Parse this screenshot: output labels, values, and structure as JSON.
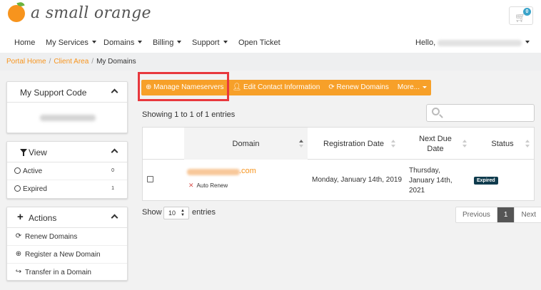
{
  "brand": {
    "logo_text": "a small orange",
    "orange_color": "#f7941d",
    "leaf_color": "#6cb33f"
  },
  "cart": {
    "count": "0",
    "icon": "cart-icon"
  },
  "nav": {
    "items": [
      {
        "label": "Home"
      },
      {
        "label": "My Services"
      },
      {
        "label": "Domains"
      },
      {
        "label": "Billing"
      },
      {
        "label": "Support"
      },
      {
        "label": "Open Ticket"
      }
    ],
    "hello": "Hello,"
  },
  "breadcrumb": {
    "home": "Portal Home",
    "client_area": "Client Area",
    "current": "My Domains",
    "separator": "/"
  },
  "sidebar": {
    "support_code": {
      "title": "My Support Code"
    },
    "view": {
      "title": "View",
      "items": [
        {
          "label": "Active",
          "count": "0"
        },
        {
          "label": "Expired",
          "count": "1"
        }
      ]
    },
    "actions": {
      "title": "Actions",
      "items": [
        {
          "label": "Renew Domains",
          "icon": "refresh-icon"
        },
        {
          "label": "Register a New Domain",
          "icon": "globe-icon"
        },
        {
          "label": "Transfer in a Domain",
          "icon": "share-icon"
        }
      ]
    }
  },
  "toolbar": {
    "manage_nameservers": "Manage Nameservers",
    "edit_contact": "Edit Contact Information",
    "renew_domains": "Renew Domains",
    "more": "More...",
    "accent": "#f7a029",
    "highlight_color": "#e8383d"
  },
  "table": {
    "showing": "Showing 1 to 1 of 1 entries",
    "columns": [
      "Domain",
      "Registration Date",
      "Next Due Date",
      "Status"
    ],
    "rows": [
      {
        "domain_suffix": ".com",
        "auto_renew": "Auto Renew",
        "registration_date": "Monday, January 14th, 2019",
        "next_due_date": "Thursday, January 14th, 2021",
        "status": "Expired"
      }
    ],
    "status_color": "#0f3b4d"
  },
  "footer": {
    "show": "Show",
    "page_size": "10",
    "entries": "entries",
    "pagination": {
      "previous": "Previous",
      "current": "1",
      "next": "Next"
    }
  }
}
